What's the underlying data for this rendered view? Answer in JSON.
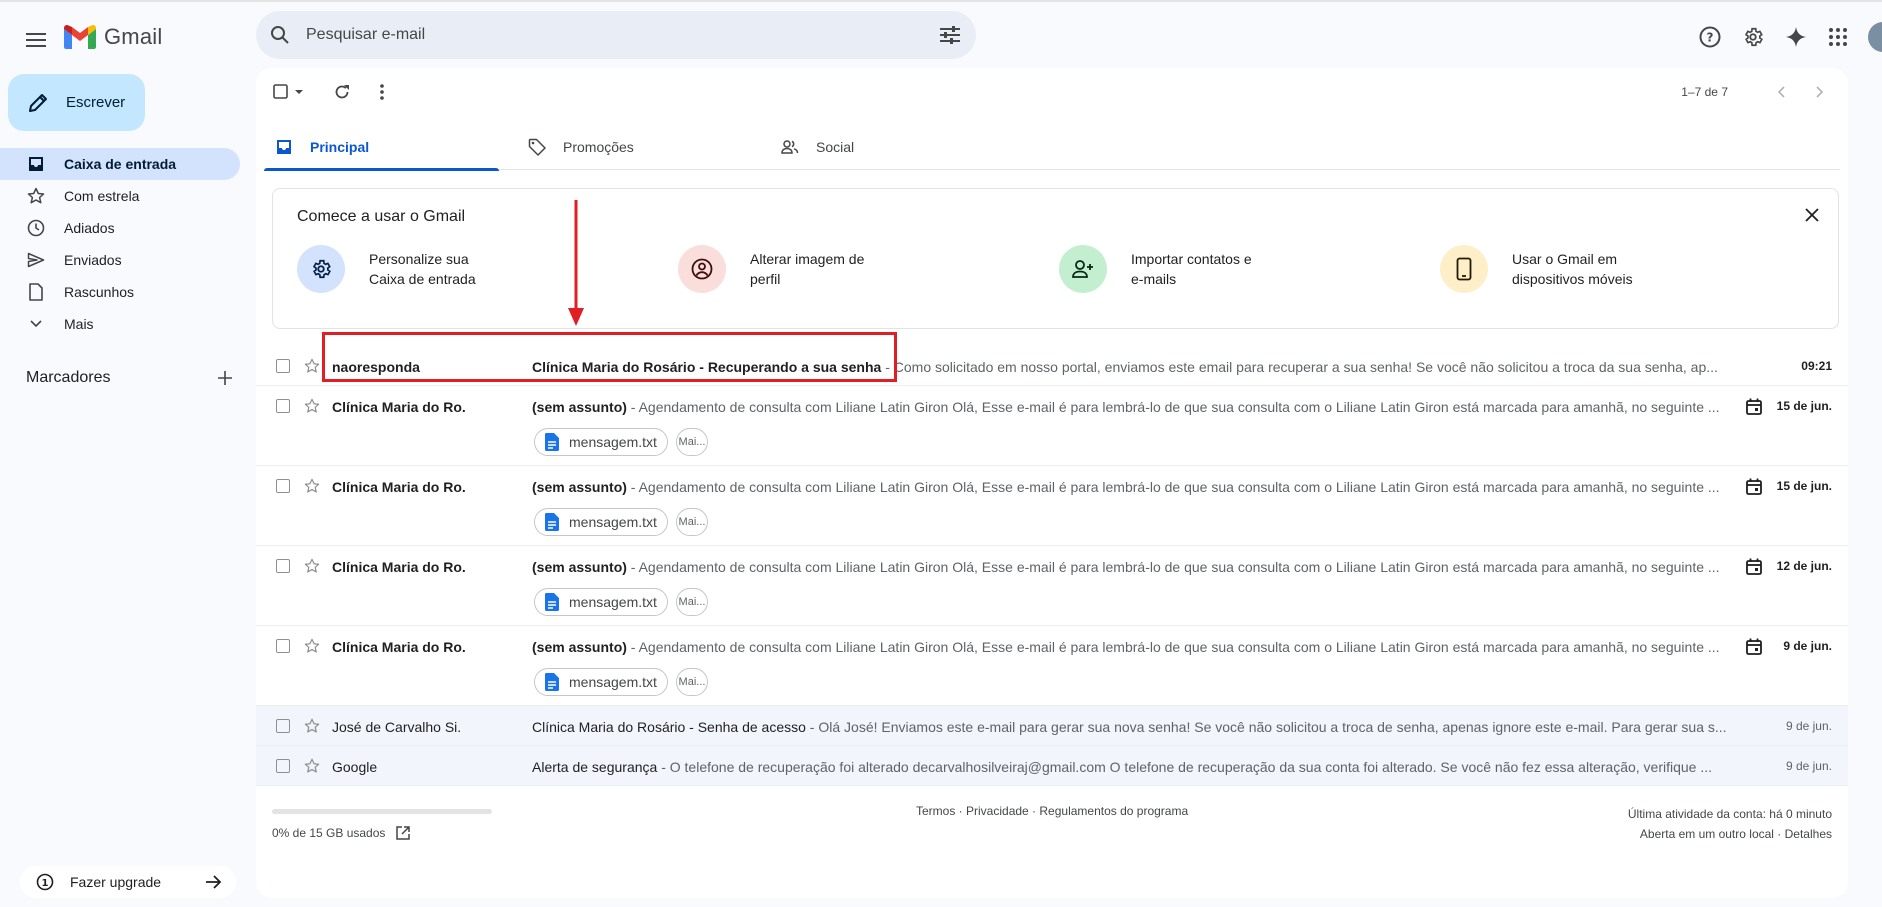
{
  "header": {
    "app_name": "Gmail",
    "search_placeholder": "Pesquisar e-mail"
  },
  "sidebar": {
    "compose_label": "Escrever",
    "items": [
      {
        "label": "Caixa de entrada",
        "icon": "inbox-icon",
        "active": true
      },
      {
        "label": "Com estrela",
        "icon": "star-icon"
      },
      {
        "label": "Adiados",
        "icon": "clock-icon"
      },
      {
        "label": "Enviados",
        "icon": "send-icon"
      },
      {
        "label": "Rascunhos",
        "icon": "draft-icon"
      },
      {
        "label": "Mais",
        "icon": "chevron-down-icon"
      }
    ],
    "labels_title": "Marcadores",
    "upgrade_label": "Fazer upgrade"
  },
  "toolbar": {
    "pager": "1–7 de 7"
  },
  "tabs": [
    {
      "label": "Principal",
      "icon": "inbox-tab-icon",
      "active": true
    },
    {
      "label": "Promoções",
      "icon": "tag-icon"
    },
    {
      "label": "Social",
      "icon": "people-icon"
    }
  ],
  "get_started": {
    "title": "Comece a usar o Gmail",
    "items": [
      {
        "text": "Personalize sua Caixa de entrada",
        "color": "#d3e3fd",
        "icon": "gear-icon"
      },
      {
        "text": "Alterar imagem de perfil",
        "color": "#f9dedc",
        "icon": "account-circle-icon"
      },
      {
        "text": "Importar contatos e e-mails",
        "color": "#c4eed0",
        "icon": "person-add-icon"
      },
      {
        "text": "Usar o Gmail em dispositivos móveis",
        "color": "#ffefc9",
        "icon": "phone-icon"
      }
    ]
  },
  "emails": [
    {
      "sender": "naoresponda",
      "subject": "Clínica Maria do Rosário - Recuperando a sua senha",
      "snippet": "Como solicitado em nosso portal, enviamos este email para recuperar a sua senha! Se você não solicitou a troca da sua senha, ap...",
      "date": "09:21",
      "unread": true,
      "calendar": false,
      "attachment": false
    },
    {
      "sender": "Clínica Maria do Ro.",
      "subject": "(sem assunto)",
      "snippet": "Agendamento de consulta com Liliane Latin Giron Olá, Esse e-mail é para lembrá-lo de que sua consulta com o Liliane Latin Giron está marcada para amanhã, no seguinte ...",
      "date": "15 de jun.",
      "unread": true,
      "calendar": true,
      "attachment": true
    },
    {
      "sender": "Clínica Maria do Ro.",
      "subject": "(sem assunto)",
      "snippet": "Agendamento de consulta com Liliane Latin Giron Olá, Esse e-mail é para lembrá-lo de que sua consulta com o Liliane Latin Giron está marcada para amanhã, no seguinte ...",
      "date": "15 de jun.",
      "unread": true,
      "calendar": true,
      "attachment": true
    },
    {
      "sender": "Clínica Maria do Ro.",
      "subject": "(sem assunto)",
      "snippet": "Agendamento de consulta com Liliane Latin Giron Olá, Esse e-mail é para lembrá-lo de que sua consulta com o Liliane Latin Giron está marcada para amanhã, no seguinte ...",
      "date": "12 de jun.",
      "unread": true,
      "calendar": true,
      "attachment": true
    },
    {
      "sender": "Clínica Maria do Ro.",
      "subject": "(sem assunto)",
      "snippet": "Agendamento de consulta com Liliane Latin Giron Olá, Esse e-mail é para lembrá-lo de que sua consulta com o Liliane Latin Giron está marcada para amanhã, no seguinte ...",
      "date": "9 de jun.",
      "unread": true,
      "calendar": true,
      "attachment": true
    },
    {
      "sender": "José de Carvalho Si.",
      "subject": "Clínica Maria do Rosário - Senha de acesso",
      "snippet": "Olá José! Enviamos este e-mail para gerar sua nova senha! Se você não solicitou a troca de senha, apenas ignore este e-mail. Para gerar sua s...",
      "date": "9 de jun.",
      "unread": false,
      "calendar": false,
      "attachment": false
    },
    {
      "sender": "Google",
      "subject": "Alerta de segurança",
      "snippet": "O telefone de recuperação foi alterado decarvalhosilveiraj@gmail.com O telefone de recuperação da sua conta foi alterado. Se você não fez essa alteração, verifique ...",
      "date": "9 de jun.",
      "unread": false,
      "calendar": false,
      "attachment": false
    }
  ],
  "attachment": {
    "name": "mensagem.txt",
    "more": "Mai..."
  },
  "footer": {
    "storage": "0% de 15 GB usados",
    "storage_fraction": 0,
    "links": [
      "Termos",
      "Privacidade",
      "Regulamentos do programa"
    ],
    "activity_line1": "Última atividade da conta: há 0 minuto",
    "activity_line2": "Aberta em um outro local",
    "details": "Detalhes"
  },
  "colors": {
    "accent": "#0b57d0",
    "compose_bg": "#c2e7ff",
    "active_nav": "#d3e3fd",
    "annotation": "#e01e24"
  }
}
